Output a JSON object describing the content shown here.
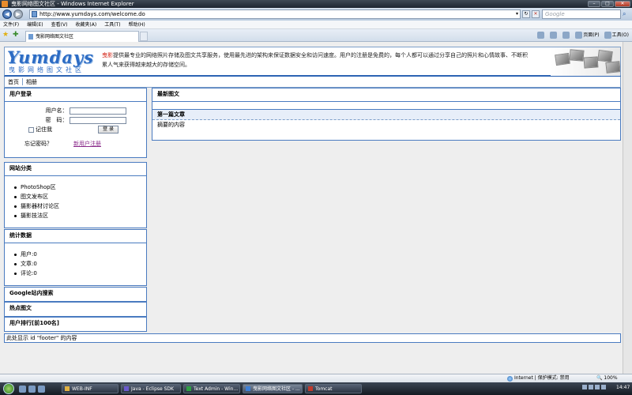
{
  "window": {
    "title": "曳影网络图文社区 - Windows Internet Explorer",
    "buttons": [
      "–",
      "□",
      "✕"
    ]
  },
  "address_bar": {
    "url": "http://www.yumdays.com/welcome.do",
    "search_placeholder": "Google"
  },
  "menu": [
    "文件(F)",
    "编辑(E)",
    "查看(V)",
    "收藏夹(A)",
    "工具(T)",
    "帮助(H)"
  ],
  "tab": {
    "label": "曳影网络图文社区"
  },
  "command_bar": {
    "page_label": "页面(P)",
    "tools_label": "工具(O)"
  },
  "site": {
    "logo": "Yumdays",
    "logo_tagline": "曳影网络图文社区",
    "intro_brand": "曳影",
    "intro_text": "提供最专业的网络照片存储及图文共享服务，使用最先进的架构来保证数据安全和访问速度。用户的注册是免费的，每个人都可以通过分享自己的照片和心情故事、不断积累人气来获得越来越大的存储空间。",
    "nav": [
      "首页",
      "相册"
    ]
  },
  "login": {
    "title": "用户登录",
    "username_label": "用户名：",
    "password_label": "密　码：",
    "remember_label": "记住我",
    "submit_label": "登 录",
    "forgot_label": "忘记密码？",
    "register_label": "新用户注册"
  },
  "categories": {
    "title": "网站分类",
    "items": [
      "PhotoShop区",
      "图文发布区",
      "摄影器材讨论区",
      "摄影技法区"
    ]
  },
  "stats": {
    "title": "统计数据",
    "items": [
      "用户:0",
      "文章:0",
      "评论:0"
    ]
  },
  "google_search": {
    "title": "Google站内搜索"
  },
  "hot_images": {
    "title": "热点图文"
  },
  "user_rank": {
    "title": "用户排行[前100名]"
  },
  "main": {
    "title": "最新图文",
    "article_title": "第一篇文章",
    "article_summary": "摘要的内容"
  },
  "footer": {
    "text": "此处显示 id \"footer\" 的内容"
  },
  "status_bar": {
    "zone": "Internet | 保护模式: 禁用",
    "zoom": "100%"
  },
  "taskbar": {
    "tasks": [
      "WEB-INF",
      "Java - Eclipse SDK",
      "Text Admin - Win...",
      "曳影网络图文社区 - ...",
      "Tomcat"
    ],
    "clock": "14:47"
  }
}
